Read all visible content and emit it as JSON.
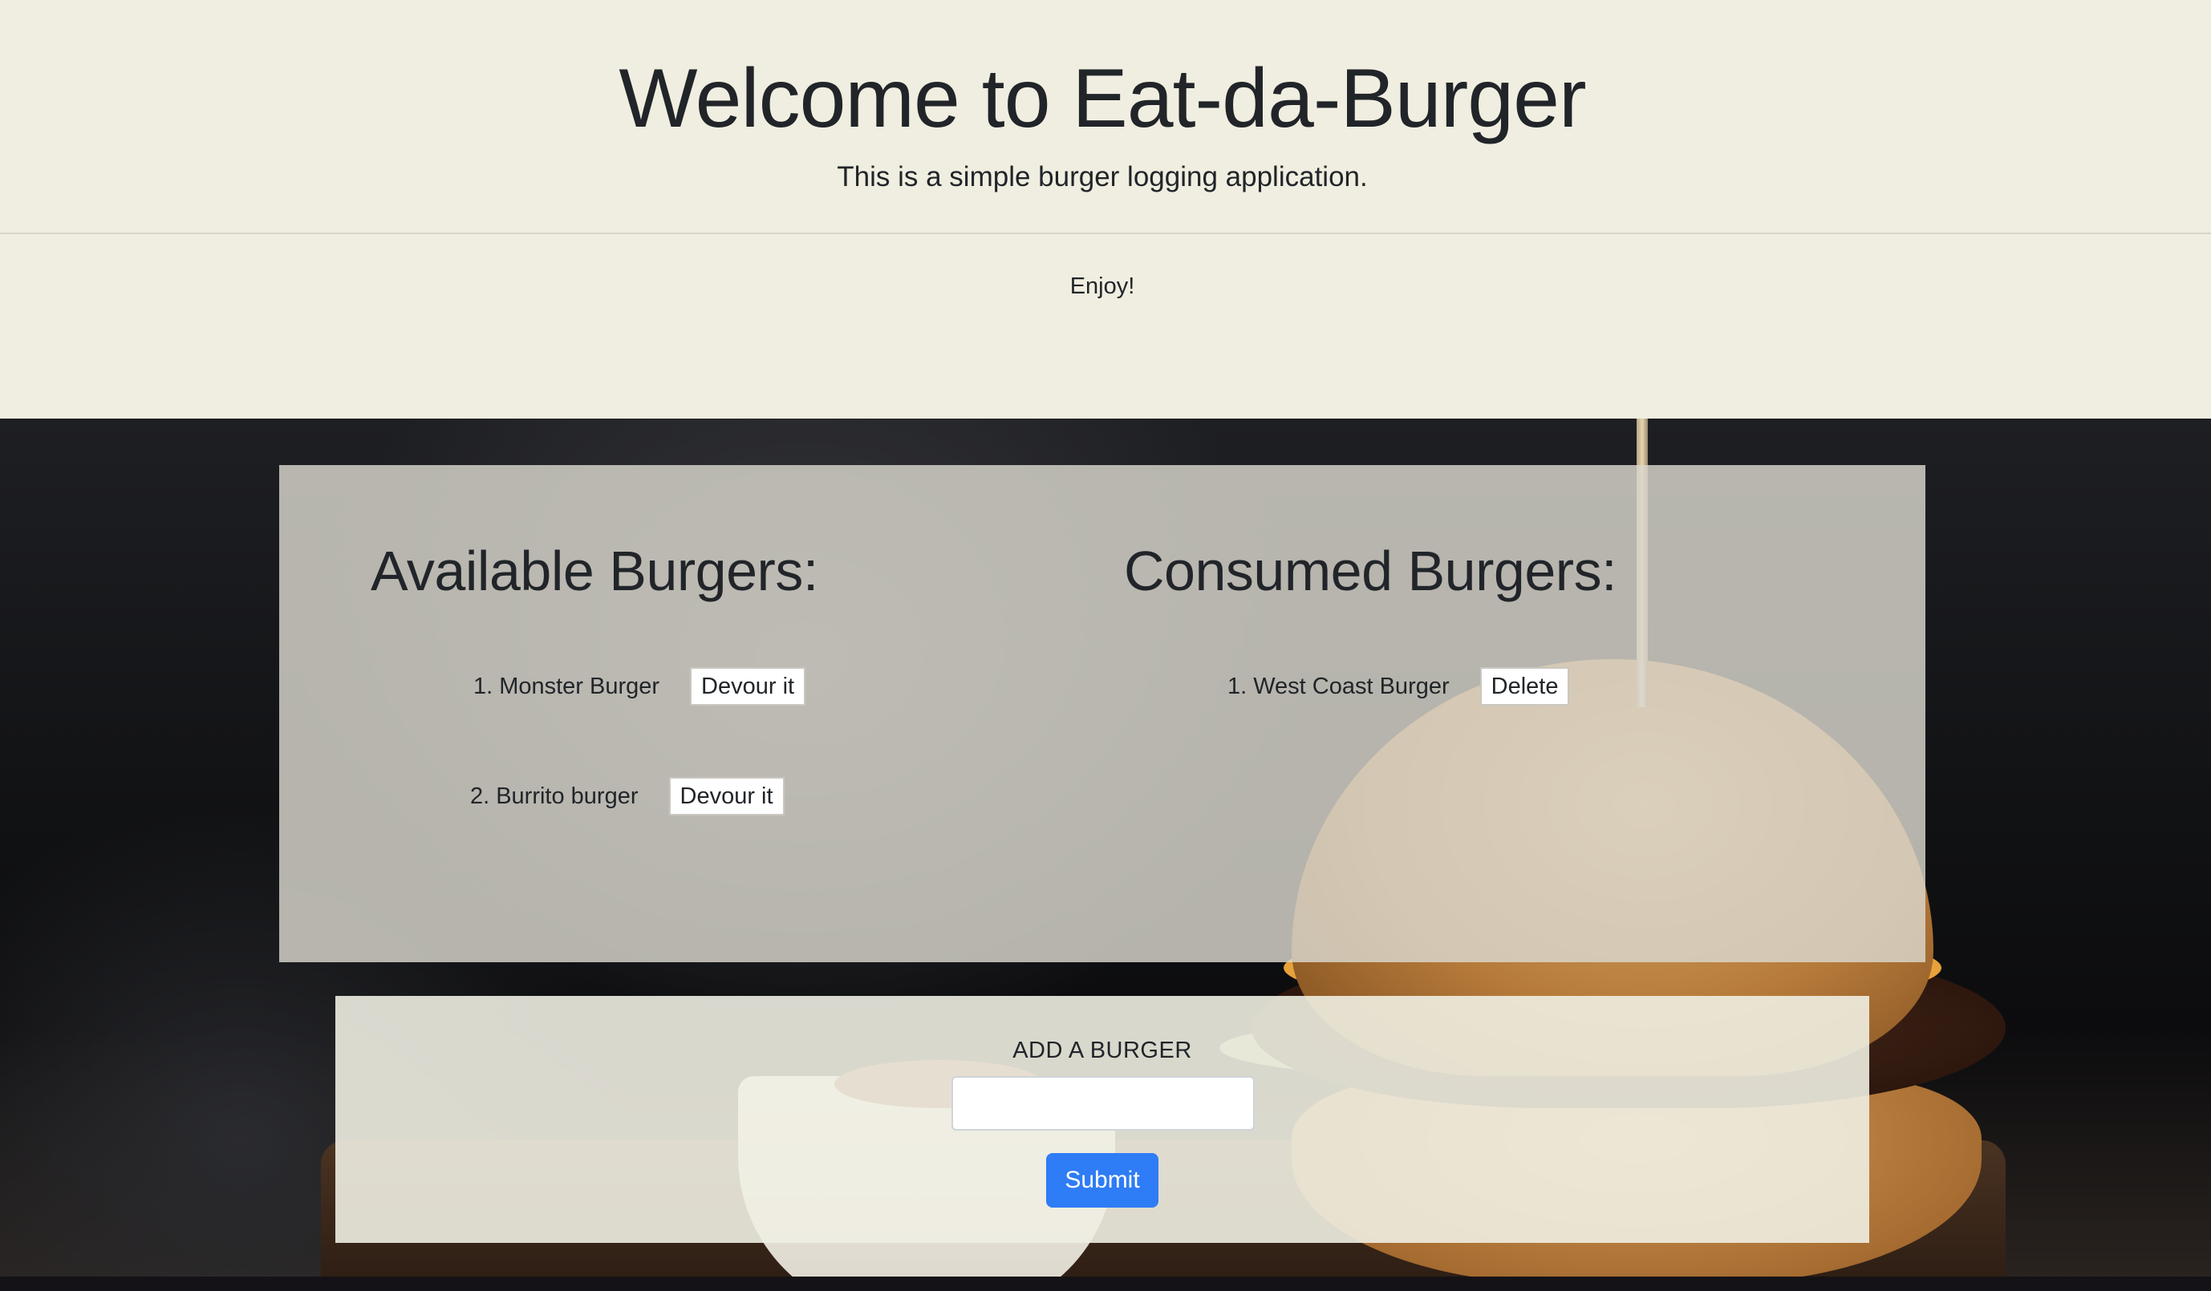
{
  "header": {
    "title": "Welcome to Eat-da-Burger",
    "lead": "This is a simple burger logging application.",
    "enjoy": "Enjoy!"
  },
  "available": {
    "title": "Available Burgers:",
    "items": [
      {
        "num": "1.",
        "name": "Monster Burger",
        "action": "Devour it"
      },
      {
        "num": "2.",
        "name": "Burrito burger",
        "action": "Devour it"
      }
    ]
  },
  "consumed": {
    "title": "Consumed Burgers:",
    "items": [
      {
        "num": "1.",
        "name": "West Coast Burger",
        "action": "Delete"
      }
    ]
  },
  "add_form": {
    "label": "ADD A BURGER",
    "input_value": "",
    "submit_label": "Submit"
  },
  "colors": {
    "header_bg": "#f0eee0",
    "primary": "#2e7cf6",
    "text": "#212529"
  }
}
